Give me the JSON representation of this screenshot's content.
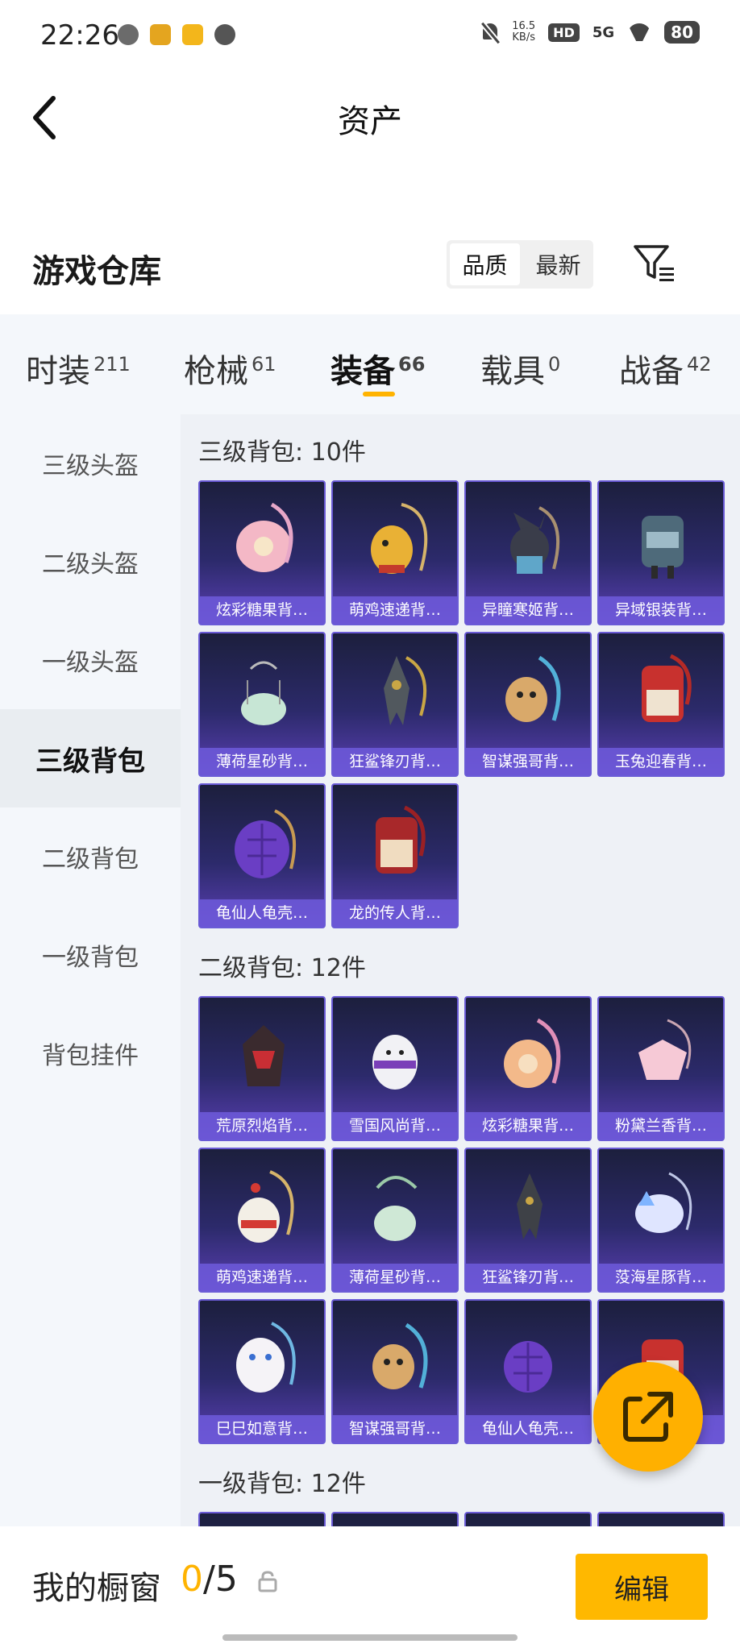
{
  "status_bar": {
    "time": "22:26",
    "net_speed_value": "16.5",
    "net_speed_unit": "KB/s",
    "hd": "HD",
    "signal": "5G",
    "battery": "80"
  },
  "nav": {
    "title": "资产",
    "back_icon": "chevron-left-icon"
  },
  "warehouse": {
    "title": "游戏仓库",
    "sort_options": [
      "品质",
      "最新"
    ],
    "active_sort": "品质",
    "filter_icon": "filter-icon"
  },
  "tabs": [
    {
      "label": "时装",
      "count": "211"
    },
    {
      "label": "枪械",
      "count": "61"
    },
    {
      "label": "装备",
      "count": "66"
    },
    {
      "label": "载具",
      "count": "0"
    },
    {
      "label": "战备",
      "count": "42"
    }
  ],
  "active_tab": "装备",
  "sidebar": [
    "三级头盔",
    "二级头盔",
    "一级头盔",
    "三级背包",
    "二级背包",
    "一级背包",
    "背包挂件"
  ],
  "active_sidebar": "三级背包",
  "sections": [
    {
      "label": "三级背包: 10件",
      "items": [
        "炫彩糖果背…",
        "萌鸡速递背…",
        "异瞳寒姬背…",
        "异域银装背…",
        "薄荷星砂背…",
        "狂鲨锋刃背…",
        "智谋强哥背…",
        "玉兔迎春背…",
        "龟仙人龟壳…",
        "龙的传人背…"
      ]
    },
    {
      "label": "二级背包: 12件",
      "items": [
        "荒原烈焰背…",
        "雪国风尚背…",
        "炫彩糖果背…",
        "粉黛兰香背…",
        "萌鸡速递背…",
        "薄荷星砂背…",
        "狂鲨锋刃背…",
        "莈海星豚背…",
        "巳巳如意背…",
        "智谋强哥背…",
        "龟仙人龟壳…",
        ""
      ]
    },
    {
      "label": "一级背包: 12件",
      "items": []
    }
  ],
  "bottom": {
    "showcase_label": "我的橱窗",
    "count_current": "0",
    "count_sep": "/",
    "count_max": "5",
    "edit_label": "编辑"
  },
  "colors": {
    "accent": "#ffb300",
    "card_purple": "#5a3fb3"
  }
}
